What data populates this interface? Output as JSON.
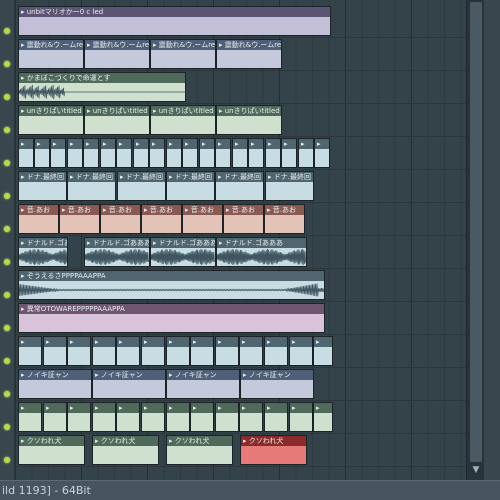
{
  "status_bar": {
    "text": "ild 1193] - 64Bit"
  },
  "scrollbar": {
    "down_arrow_icon": "triangle-down"
  },
  "tracks": [
    {
      "header_color": "#5a5574",
      "body_color": "#c3bfd6",
      "kind": "automation",
      "clips": [
        {
          "label": "▸ unbitマリオかー0 c led"
        }
      ]
    },
    {
      "header_color": "#4f5f78",
      "body_color": "#c4cadb",
      "kind": "automation",
      "clips": [
        {
          "label": "▸ 震動れ&ウ.ームre"
        },
        {
          "label": "▸ 震動れ&ウ.ームre"
        },
        {
          "label": "▸ 震動れ&ウ.ームre"
        },
        {
          "label": "▸ 震動れ&ウ.ームre"
        }
      ]
    },
    {
      "header_color": "#4f6a5a",
      "body_color": "#cfe0cf",
      "kind": "audio-intro",
      "clips": [
        {
          "label": "▸ かまぼこづくりで命運とす"
        }
      ]
    },
    {
      "header_color": "#4f6a5a",
      "body_color": "#cfe0cf",
      "kind": "automation",
      "clips": [
        {
          "label": "▸ unきりぱいtitled"
        },
        {
          "label": "▸ unきりぱいtitled"
        },
        {
          "label": "▸ unきりぱいtitled"
        },
        {
          "label": "▸ unきりぱいtitled"
        }
      ]
    },
    {
      "header_color": "#4f6670",
      "body_color": "#c8dce3",
      "kind": "pattern",
      "clips": [
        {
          "label": "▸"
        },
        {
          "label": "▸"
        },
        {
          "label": "▸"
        },
        {
          "label": "▸"
        },
        {
          "label": "▸"
        },
        {
          "label": "▸"
        },
        {
          "label": "▸"
        },
        {
          "label": "▸"
        },
        {
          "label": "▸"
        },
        {
          "label": "▸"
        },
        {
          "label": "▸"
        },
        {
          "label": "▸"
        },
        {
          "label": "▸"
        },
        {
          "label": "▸"
        },
        {
          "label": "▸"
        },
        {
          "label": "▸"
        },
        {
          "label": "▸"
        },
        {
          "label": "▸"
        },
        {
          "label": "▸"
        }
      ]
    },
    {
      "header_color": "#4f6670",
      "body_color": "#c8dce3",
      "kind": "pattern",
      "clips": [
        {
          "label": "▸ ドナ.最終回"
        },
        {
          "label": "▸ ドナ.最終回"
        },
        {
          "label": "▸ ドナ.最終回"
        },
        {
          "label": "▸ ドナ.最終回"
        },
        {
          "label": "▸ ドナ.最終回"
        },
        {
          "label": "▸ ドナ.最終回"
        }
      ]
    },
    {
      "header_color": "#8a5a52",
      "body_color": "#e3c3b8",
      "kind": "pattern",
      "clips": [
        {
          "label": "▸ 音.あお"
        },
        {
          "label": "▸ 音.あお"
        },
        {
          "label": "▸ 音.あお"
        },
        {
          "label": "▸ 音.あお"
        },
        {
          "label": "▸ 音.あお"
        },
        {
          "label": "▸ 音.あお"
        },
        {
          "label": "▸ 音.あお"
        }
      ]
    },
    {
      "header_color": "#4f6670",
      "body_color": "#c8dce3",
      "kind": "audio-wave",
      "clips": [
        {
          "label": "▸ ドナルド.ゴあああ"
        },
        {
          "label": "▸ ドナルド.ゴあああ"
        },
        {
          "label": "▸ ドナルド.ゴあああ"
        },
        {
          "label": "▸ ドナルド.ゴあああ"
        }
      ]
    },
    {
      "header_color": "#4f6670",
      "body_color": "#c8dce3",
      "kind": "audio-long",
      "clips": [
        {
          "label": "▸ ぞうえるさPPPPAAAPPA"
        }
      ]
    },
    {
      "header_color": "#6e5570",
      "body_color": "#d8c3da",
      "kind": "automation",
      "clips": [
        {
          "label": "▸ 異常OTOWAREPPPPPAAAPPA"
        }
      ]
    },
    {
      "header_color": "#4f6670",
      "body_color": "#c8dce3",
      "kind": "pattern",
      "clips": [
        {
          "label": "▸"
        },
        {
          "label": "▸"
        },
        {
          "label": "▸"
        },
        {
          "label": "▸"
        },
        {
          "label": "▸"
        },
        {
          "label": "▸"
        },
        {
          "label": "▸"
        },
        {
          "label": "▸"
        },
        {
          "label": "▸"
        },
        {
          "label": "▸"
        },
        {
          "label": "▸"
        },
        {
          "label": "▸"
        },
        {
          "label": "▸"
        }
      ]
    },
    {
      "header_color": "#4f5f78",
      "body_color": "#c4cadb",
      "kind": "pattern",
      "clips": [
        {
          "label": "▸ ノイキ証ャン"
        },
        {
          "label": "▸ ノイキ証ャン"
        },
        {
          "label": "▸ ノイキ証ャン"
        },
        {
          "label": "▸ ノイキ証ャン"
        }
      ]
    },
    {
      "header_color": "#4f6a5a",
      "body_color": "#cfe0cf",
      "kind": "pattern",
      "clips": [
        {
          "label": "▸"
        },
        {
          "label": "▸"
        },
        {
          "label": "▸"
        },
        {
          "label": "▸"
        },
        {
          "label": "▸"
        },
        {
          "label": "▸"
        },
        {
          "label": "▸"
        },
        {
          "label": "▸"
        },
        {
          "label": "▸"
        },
        {
          "label": "▸"
        },
        {
          "label": "▸"
        },
        {
          "label": "▸"
        },
        {
          "label": "▸"
        }
      ]
    },
    {
      "header_color": "#4f6a5a",
      "body_color": "#cfe0cf",
      "kind": "pattern",
      "clips": [
        {
          "label": "▸ クソわれ犬"
        },
        {
          "label": "▸ クソわれ犬"
        },
        {
          "label": "▸ クソわれ犬"
        },
        {
          "label": "▸ クソわれ犬",
          "header_color": "#8a2a2a",
          "body_color": "#e67a78"
        }
      ]
    }
  ]
}
